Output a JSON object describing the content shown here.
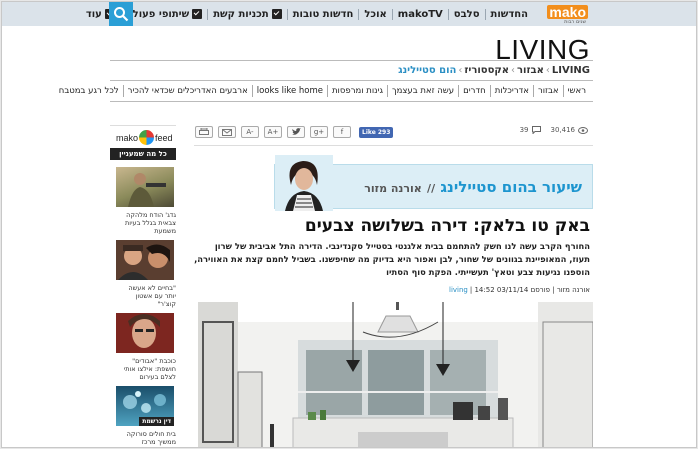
{
  "nav": {
    "logo": "mako",
    "logo_sub": "שנים רבות",
    "items": [
      {
        "label": "החדשות",
        "check": false
      },
      {
        "label": "סלבס",
        "check": false
      },
      {
        "label": "makoTV",
        "check": false
      },
      {
        "label": "אוכל",
        "check": false
      },
      {
        "label": "חדשות טובות",
        "check": false
      },
      {
        "label": "תכניות קשת",
        "check": true
      },
      {
        "label": "שיתופי פעולה",
        "check": true
      },
      {
        "label": "עוד",
        "check": true
      }
    ]
  },
  "section_title": "LIVING",
  "breadcrumb": {
    "items": [
      "LIVING",
      "אבזור",
      "אקססוריז"
    ],
    "current": "הום סטיילינג",
    "sep": "›"
  },
  "subnav": [
    "ראשי",
    "אבזור",
    "אדריכלות",
    "חדרים",
    "עשה זאת בעצמך",
    "גינות ומרפסות",
    "looks like home",
    "ארבעים האדריכלים שכדאי להכיר",
    "לכל רגע במטבח"
  ],
  "sidebar": {
    "logo_left": "mako",
    "logo_right": "feed",
    "title": "כל מה שמעניין",
    "items": [
      {
        "caption": "גדג' הודח מלהקה צבאית בגלל בעיות משמעת",
        "tag": ""
      },
      {
        "caption": "\"בחיים לא אעשה יותר עם אשטון קוצ'ר\"",
        "tag": ""
      },
      {
        "caption": "כוכבת \"אבודים\" חושפת: אילצו אותי לצלם בעירום",
        "tag": ""
      },
      {
        "caption": "בית חולים סורוקה ממשיך מרכז אונקולוגי",
        "tag": "דין נרשמת"
      }
    ]
  },
  "social": {
    "buttons": [
      "print",
      "mail",
      "A-",
      "A+",
      "twitter",
      "g+",
      "f"
    ],
    "like_label": "Like 293"
  },
  "stats": {
    "comments": "39",
    "views": "30,416"
  },
  "banner": {
    "title": "שיעור בהום סטיילינג",
    "sep": "//",
    "author": "אורנה מזור"
  },
  "article": {
    "headline": "באק טו בלאק: דירה בשלושה צבעים",
    "lead": "החורף הקרב עשה לנו חשק להתחמם בבית אלגנטי בסטייל סקנדינבי. הדירה התל אביבית של שרון תעוז, המאופיינת בגוונים של שחור, לבן ואפור היא בדיוק מה שחיפשנו. בשביל לחמם קצת את האווירה, הוספנו נגיעות צבע וטאץ' תעשייתי. הפקת סוף הסתיו",
    "author": "אורנה מזור",
    "date": "פורסם 03/11/14 14:52",
    "section": "living"
  },
  "colors": {
    "accent": "#1d95cf",
    "search": "#2a9fd6",
    "brand": "#f28e1c"
  }
}
